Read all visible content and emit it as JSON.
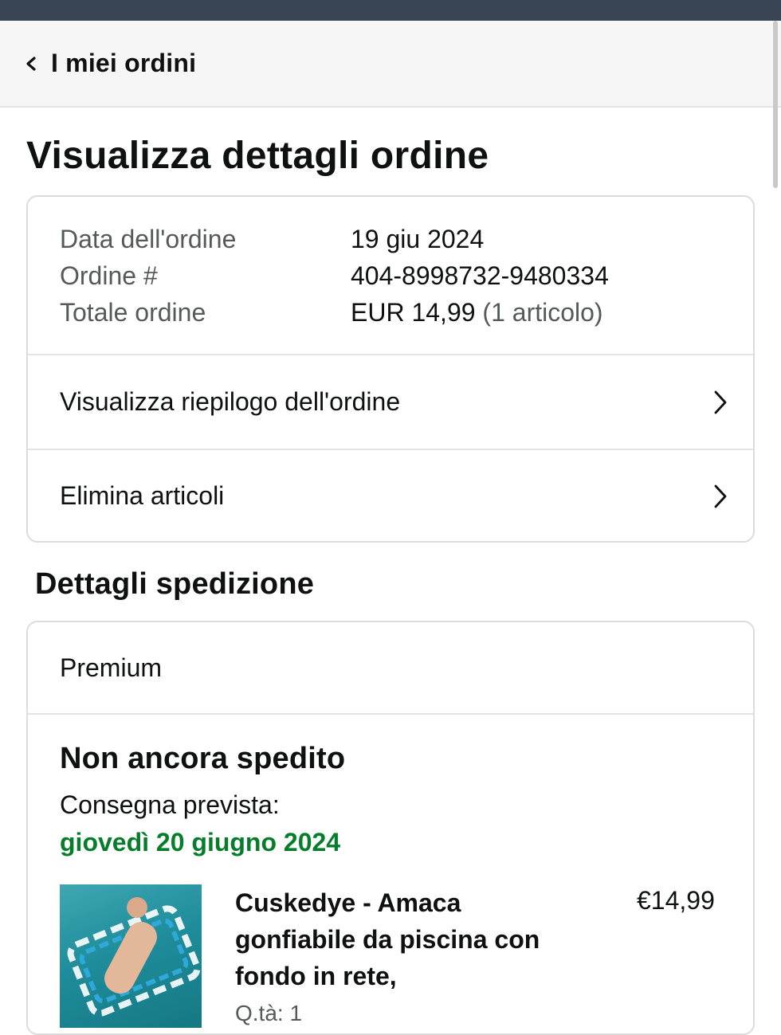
{
  "nav": {
    "back_label": "I miei ordini"
  },
  "page_title": "Visualizza dettagli ordine",
  "order": {
    "date_label": "Data dell'ordine",
    "date_value": "19 giu 2024",
    "number_label": "Ordine #",
    "number_value": "404-8998732-9480334",
    "total_label": "Totale ordine",
    "total_value": "EUR 14,99",
    "total_items": "(1 articolo)"
  },
  "actions": {
    "summary_label": "Visualizza riepilogo dell'ordine",
    "delete_label": "Elimina articoli"
  },
  "shipping": {
    "section_title": "Dettagli spedizione",
    "method": "Premium",
    "status": "Non ancora spedito",
    "delivery_label": "Consegna prevista:",
    "delivery_date": "giovedì 20 giugno 2024",
    "delivery_date_color": "#067d2a"
  },
  "item": {
    "title": "Cuskedye - Amaca gonfiabile da piscina con fondo in rete,",
    "qty": "Q.tà: 1",
    "price": "€14,99"
  }
}
